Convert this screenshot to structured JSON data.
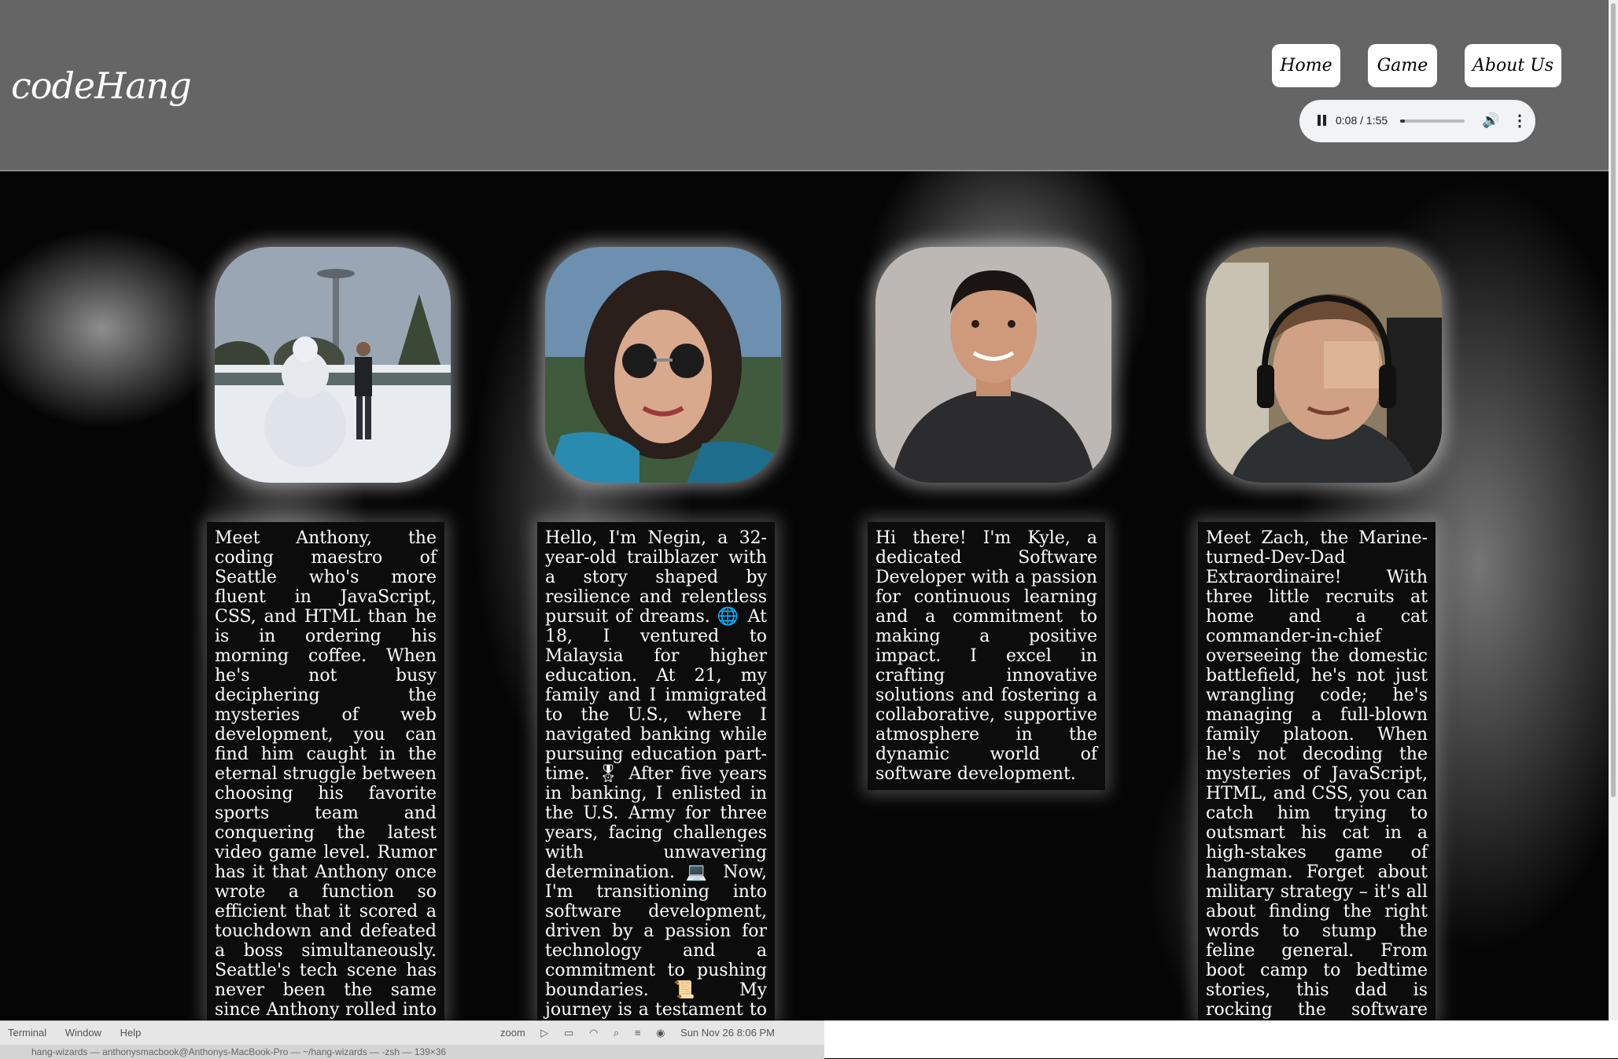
{
  "header": {
    "logo": "codeHang",
    "nav": [
      {
        "label": "Home"
      },
      {
        "label": "Game"
      },
      {
        "label": "About Us"
      }
    ],
    "audio": {
      "time": "0:08 / 1:55",
      "progress": 0.07
    }
  },
  "team": [
    {
      "bio": "Meet Anthony, the coding maestro of Seattle who's more fluent in JavaScript, CSS, and HTML than he is in ordering his morning coffee. When he's not busy deciphering the mysteries of web development, you can find him caught in the eternal struggle between choosing his favorite sports team and conquering the latest video game level. Rumor has it that Anthony once wrote a function so efficient that it scored a touchdown and defeated a boss simultaneously. Seattle's tech scene has never been the same since Anthony rolled into town, armed with a laptop and a passion for coding that rivals his love for a well-executed slam dunk or a"
    },
    {
      "bio": "Hello, I'm Negin, a 32-year-old trailblazer with a story shaped by resilience and relentless pursuit of dreams. 🌐 At 18, I ventured to Malaysia for higher education. At 21, my family and I immigrated to the U.S., where I navigated banking while pursuing education part-time. 🎖 After five years in banking, I enlisted in the U.S. Army for three years, facing challenges with unwavering determination. 💻 Now, I'm transitioning into software development, driven by a passion for technology and a commitment to pushing boundaries. 📜 My journey is a testament to adaptability, resilience, and an ever-evolving pursuit of dreams. Excited for the"
    },
    {
      "bio": "Hi there! I'm Kyle, a dedicated Software Developer with a passion for continuous learning and a commitment to making a positive impact. I excel in crafting innovative solutions and fostering a collaborative, supportive atmosphere in the dynamic world of software development."
    },
    {
      "bio": "Meet Zach, the Marine-turned-Dev-Dad Extraordinaire! With three little recruits at home and a cat commander-in-chief overseeing the domestic battlefield, he's not just wrangling code; he's managing a full-blown family platoon. When he's not decoding the mysteries of JavaScript, HTML, and CSS, you can catch him trying to outsmart his cat in a high-stakes game of hangman. Forget about military strategy – it's all about finding the right words to stump the feline general. From boot camp to bedtime stories, this dad is rocking the software world and mastering the art of cat-approved wordplay. Semper Fun!"
    }
  ],
  "taskbar": {
    "menu": [
      "Terminal",
      "Window",
      "Help"
    ],
    "zoom": "zoom",
    "datetime": "Sun Nov 26  8:06 PM",
    "terminal_title": "hang-wizards — anthonysmacbook@Anthonys-MacBook-Pro — ~/hang-wizards — -zsh — 139×36"
  }
}
